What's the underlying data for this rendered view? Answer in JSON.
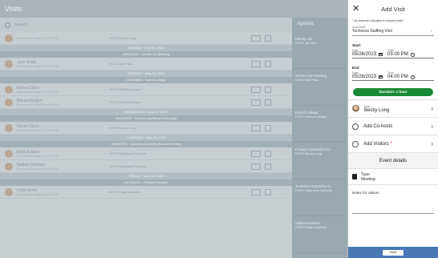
{
  "background": {
    "title": "Visits",
    "search_placeholder": "Search",
    "agenda_title": "Agenda",
    "rows": [
      {
        "type": "row",
        "name": "",
        "sub": "Scheduled for May 26 at 3:00 PM",
        "host": "HOST  Becky Long"
      },
      {
        "type": "sep",
        "label": "MONDAY · May 22, 2023"
      },
      {
        "type": "sep",
        "label": "05/22/2023 · Vendor On-Meeting",
        "dark": true
      },
      {
        "type": "row",
        "name": "Jack Smith",
        "sub": "Scheduled for May 22 at 3:00 PM",
        "host": "HOST  Sue Park"
      },
      {
        "type": "sep",
        "label": "TUESDAY · May 23, 2023"
      },
      {
        "type": "sep",
        "label": "05/23/2023 · Brand College",
        "dark": true
      },
      {
        "type": "row",
        "name": "Eloisa Dixon",
        "sub": "Scheduled for May 23 at 2:30 PM",
        "host": "HOST  DeShon Brown"
      },
      {
        "type": "row",
        "name": "Becca Borgen",
        "sub": "Scheduled for May 23 at 2:30 PM",
        "host": "HOST  DeShon Brown"
      },
      {
        "type": "sep",
        "label": "WEDNESDAY · May 24, 2023"
      },
      {
        "type": "sep",
        "label": "05/24/2023 · Finance Quarterly Accounting",
        "dark": true
      },
      {
        "type": "row",
        "name": "Nicole Dixon",
        "sub": "Scheduled for May 24 at 2:30 PM",
        "host": "HOST  Becky Long"
      },
      {
        "type": "sep",
        "label": "THURSDAY · May 25, 2023"
      },
      {
        "type": "sep",
        "label": "05/25/2023 · Technicia Quarterly Account Review",
        "dark": true
      },
      {
        "type": "row",
        "name": "Evan Adams",
        "sub": "Scheduled for May 25 at 1:00 PM",
        "host": "HOST  Stephanie Stevens"
      },
      {
        "type": "row",
        "name": "Nathan Duncan",
        "sub": "Scheduled for May 25 at 1:00 PM",
        "host": "HOST  Stephanie Stevens"
      },
      {
        "type": "sep",
        "label": "FRIDAY · May 26, 2023"
      },
      {
        "type": "sep",
        "label": "05/26/2023 · Onboard Remote",
        "dark": true
      },
      {
        "type": "row",
        "name": "Colin Smith",
        "sub": "Scheduled for May 26 at 4:00 PM",
        "host": "HOST  Frank Lambert"
      }
    ],
    "agenda": [
      {
        "title": "Meetly, Inc.",
        "sub": "HOST  Jim Tan"
      },
      {
        "title": "Vendor On-Meeting",
        "sub": "HOST  Sue Park"
      },
      {
        "title": "Brand College",
        "sub": "HOST  DeShon Brown"
      },
      {
        "title": "Finance Quarterly Acc",
        "sub": "HOST  Becky Long"
      },
      {
        "title": "Technicia Quarterly Ac",
        "sub": "HOST  Stephanie Stevens"
      },
      {
        "title": "Onboard Remo",
        "sub": "HOST  Frank Lambert"
      }
    ]
  },
  "panel": {
    "title": "Add Visit",
    "close_glyph": "✕",
    "required_note": "An asterisk indicates a required field",
    "visit_name_label": "Visit Name",
    "visit_name_value": "Technicia Staffing Visit",
    "start_label": "Start",
    "end_label": "End",
    "date_label": "Date",
    "time_label": "Time",
    "start_date": "05/26/2023",
    "start_time": "03:00 PM",
    "end_date": "05/26/2023",
    "end_time": "04:00 PM",
    "duration": "Duration: 1 hour",
    "host_label": "Host",
    "host_value": "Becky Long",
    "cohosts_label": "Add Co-hosts",
    "visitors_label": "Add Visitors",
    "visitors_required": "*",
    "event_details": "Event details",
    "type_label": "Type",
    "type_value": "Meeting",
    "notes_label": "Notes for visitors",
    "save_label": "SAVE",
    "accent_green": "#1b8a36",
    "accent_blue": "#4a78b5"
  }
}
